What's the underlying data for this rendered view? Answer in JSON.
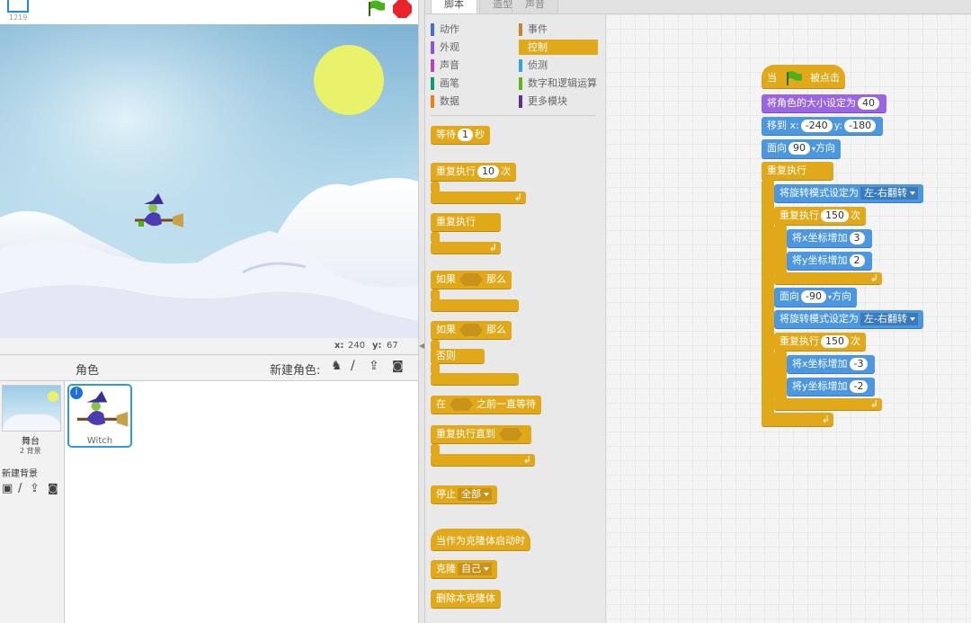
{
  "stage": {
    "mini_label": "1219",
    "coords": {
      "x_label": "x:",
      "x_value": "240",
      "y_label": "y:",
      "y_value": "67"
    }
  },
  "sprites": {
    "header_title": "角色",
    "new_sprite_label": "新建角色:",
    "stage_name": "舞台",
    "stage_backdrops": "2 背景",
    "new_backdrop_label": "新建背景",
    "items": [
      {
        "name": "Witch"
      }
    ]
  },
  "tabs": [
    "脚本",
    "造型",
    "声音"
  ],
  "categories": [
    {
      "label": "动作",
      "color": "#4a6cd4"
    },
    {
      "label": "事件",
      "color": "#c88330"
    },
    {
      "label": "外观",
      "color": "#8a55d7"
    },
    {
      "label": "控制",
      "color": "#e1a91a",
      "selected": true
    },
    {
      "label": "声音",
      "color": "#bb42c3"
    },
    {
      "label": "侦测",
      "color": "#2ca5e2"
    },
    {
      "label": "画笔",
      "color": "#0e9a6c"
    },
    {
      "label": "数字和逻辑运算",
      "color": "#5cb712"
    },
    {
      "label": "数据",
      "color": "#ee7d16"
    },
    {
      "label": "更多模块",
      "color": "#632d99"
    }
  ],
  "palette": {
    "wait": {
      "label": "等待",
      "value": "1",
      "unit": "秒"
    },
    "repeat": {
      "label": "重复执行",
      "value": "10",
      "unit": "次"
    },
    "forever": {
      "label": "重复执行"
    },
    "if_then": {
      "label": "如果",
      "then": "那么"
    },
    "if_else": {
      "label": "如果",
      "then": "那么",
      "else": "否则"
    },
    "wait_until": {
      "label": "在",
      "suffix": "之前一直等待"
    },
    "repeat_until": {
      "label": "重复执行直到"
    },
    "stop": {
      "label": "停止",
      "option": "全部"
    },
    "clone_start": {
      "label": "当作为克隆体启动时"
    },
    "clone": {
      "label": "克隆",
      "option": "自己"
    },
    "delete_clone": {
      "label": "删除本克隆体"
    }
  },
  "script": {
    "hat": {
      "prefix": "当",
      "suffix": "被点击"
    },
    "set_size": {
      "label": "将角色的大小设定为",
      "value": "40"
    },
    "goto": {
      "label": "移到 x:",
      "x": "-240",
      "y_label": "y:",
      "y": "-180"
    },
    "point": {
      "label": "面向",
      "value": "90",
      "suffix": "方向"
    },
    "forever": {
      "label": "重复执行"
    },
    "rot1": {
      "label": "将旋转模式设定为",
      "option": "左-右翻转"
    },
    "rep1": {
      "label": "重复执行",
      "value": "150",
      "unit": "次"
    },
    "cx1": {
      "label": "将x坐标增加",
      "value": "3"
    },
    "cy1": {
      "label": "将y坐标增加",
      "value": "2"
    },
    "point2": {
      "label": "面向",
      "value": "-90",
      "suffix": "方向"
    },
    "rot2": {
      "label": "将旋转模式设定为",
      "option": "左-右翻转"
    },
    "rep2": {
      "label": "重复执行",
      "value": "150",
      "unit": "次"
    },
    "cx2": {
      "label": "将x坐标增加",
      "value": "-3"
    },
    "cy2": {
      "label": "将y坐标增加",
      "value": "-2"
    }
  },
  "colors": {
    "control": "#e1a91a",
    "motion": "#4c97e0",
    "looks": "#9a65e0",
    "flag": "#4caf1d",
    "stop": "#e8242a"
  }
}
